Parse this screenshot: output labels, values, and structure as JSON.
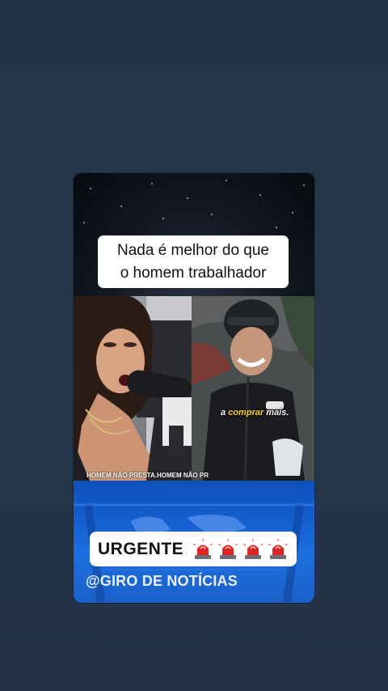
{
  "video": {
    "headline_line1": "Nada é melhor do que",
    "headline_line2": "o homem trabalhador",
    "left_caption": "HOMEM NÃO PRESTA.HOMEM NÃO PR",
    "subtitle_pre": "a ",
    "subtitle_highlight": "comprar",
    "subtitle_post": " mais.",
    "urgent_label": "URGENTE",
    "siren_count": 4,
    "handle": "@GIRO DE NOTÍCIAS"
  },
  "colors": {
    "background": "#243447",
    "lower_third_blue": "#1560d2",
    "subtitle_highlight": "#ffd21c",
    "siren_red": "#e02424"
  },
  "icons": [
    "siren-emoji-icon",
    "world-map-icon"
  ]
}
